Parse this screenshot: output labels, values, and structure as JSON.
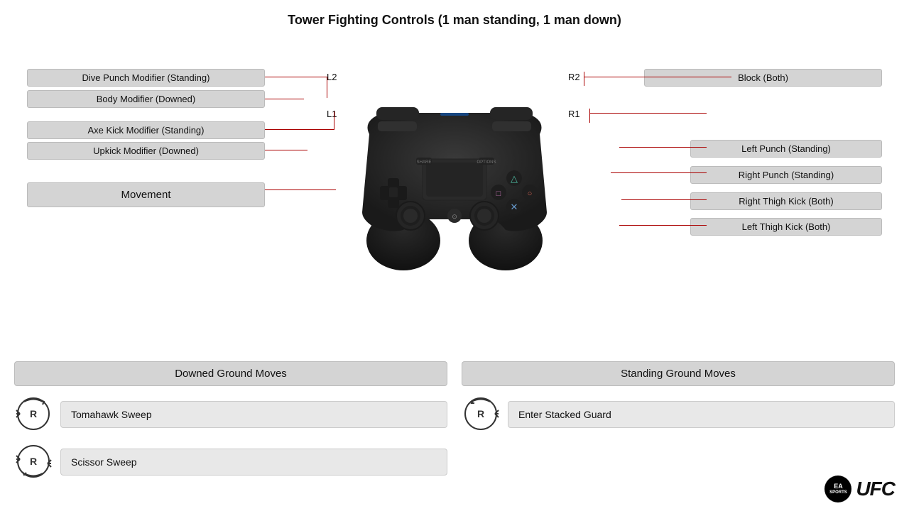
{
  "title": "Tower Fighting Controls (1 man standing, 1 man down)",
  "leftLabels": {
    "l2top": "Dive Punch Modifier (Standing)",
    "l2bottom": "Body Modifier (Downed)",
    "l1top": "Axe Kick Modifier (Standing)",
    "l1bottom": "Upkick Modifier (Downed)",
    "movement": "Movement",
    "l2": "L2",
    "l1": "L1"
  },
  "rightLabels": {
    "r2": "R2",
    "r1": "R1",
    "block": "Block (Both)",
    "leftPunch": "Left Punch (Standing)",
    "rightPunch": "Right Punch (Standing)",
    "rightThighKick": "Right Thigh Kick (Both)",
    "leftThighKick": "Left Thigh Kick (Both)"
  },
  "downedGroundMoves": {
    "title": "Downed Ground Moves",
    "moves": [
      {
        "label": "Tomahawk Sweep",
        "direction": "rotate-left"
      },
      {
        "label": "Scissor Sweep",
        "direction": "rotate-right"
      }
    ]
  },
  "standingGroundMoves": {
    "title": "Standing Ground Moves",
    "moves": [
      {
        "label": "Enter Stacked Guard",
        "direction": "rotate-left-right"
      }
    ]
  },
  "logo": {
    "ea": "EA\nSPORTS",
    "ufc": "UFC"
  }
}
